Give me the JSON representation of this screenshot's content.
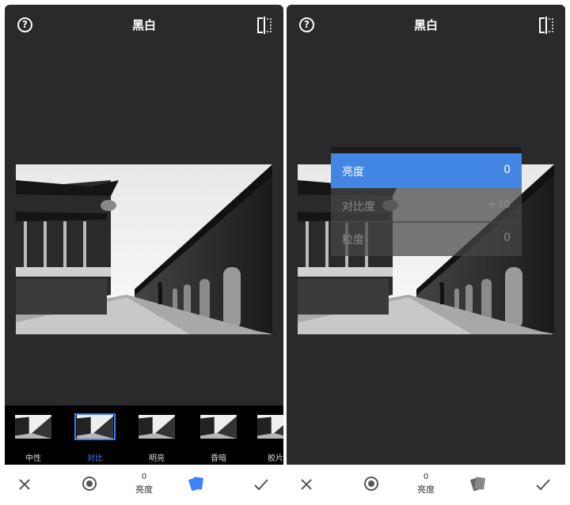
{
  "left_screen": {
    "title": "黑白",
    "styles": [
      {
        "label": "中性",
        "selected": false
      },
      {
        "label": "对比",
        "selected": true
      },
      {
        "label": "明亮",
        "selected": false
      },
      {
        "label": "昏暗",
        "selected": false
      },
      {
        "label": "胶片",
        "selected": false
      }
    ],
    "bottombar": {
      "value": "0",
      "label": "亮度",
      "active_tool": "styles"
    }
  },
  "right_screen": {
    "title": "黑白",
    "adjust_menu": [
      {
        "label": "亮度",
        "value": "0",
        "active": true
      },
      {
        "label": "对比度",
        "value": "+30",
        "active": false
      },
      {
        "label": "粒度",
        "value": "0",
        "active": false
      }
    ],
    "bottombar": {
      "value": "0",
      "label": "亮度",
      "active_tool": "none"
    }
  },
  "colors": {
    "accent": "#3e82f7",
    "menu_active": "#4285e3",
    "screen_bg": "#2a2a2a",
    "strip_bg": "#000000"
  },
  "icons": [
    "help-icon",
    "compare-icon",
    "cancel-icon",
    "tune-icon",
    "styles-icon",
    "apply-check-icon"
  ]
}
